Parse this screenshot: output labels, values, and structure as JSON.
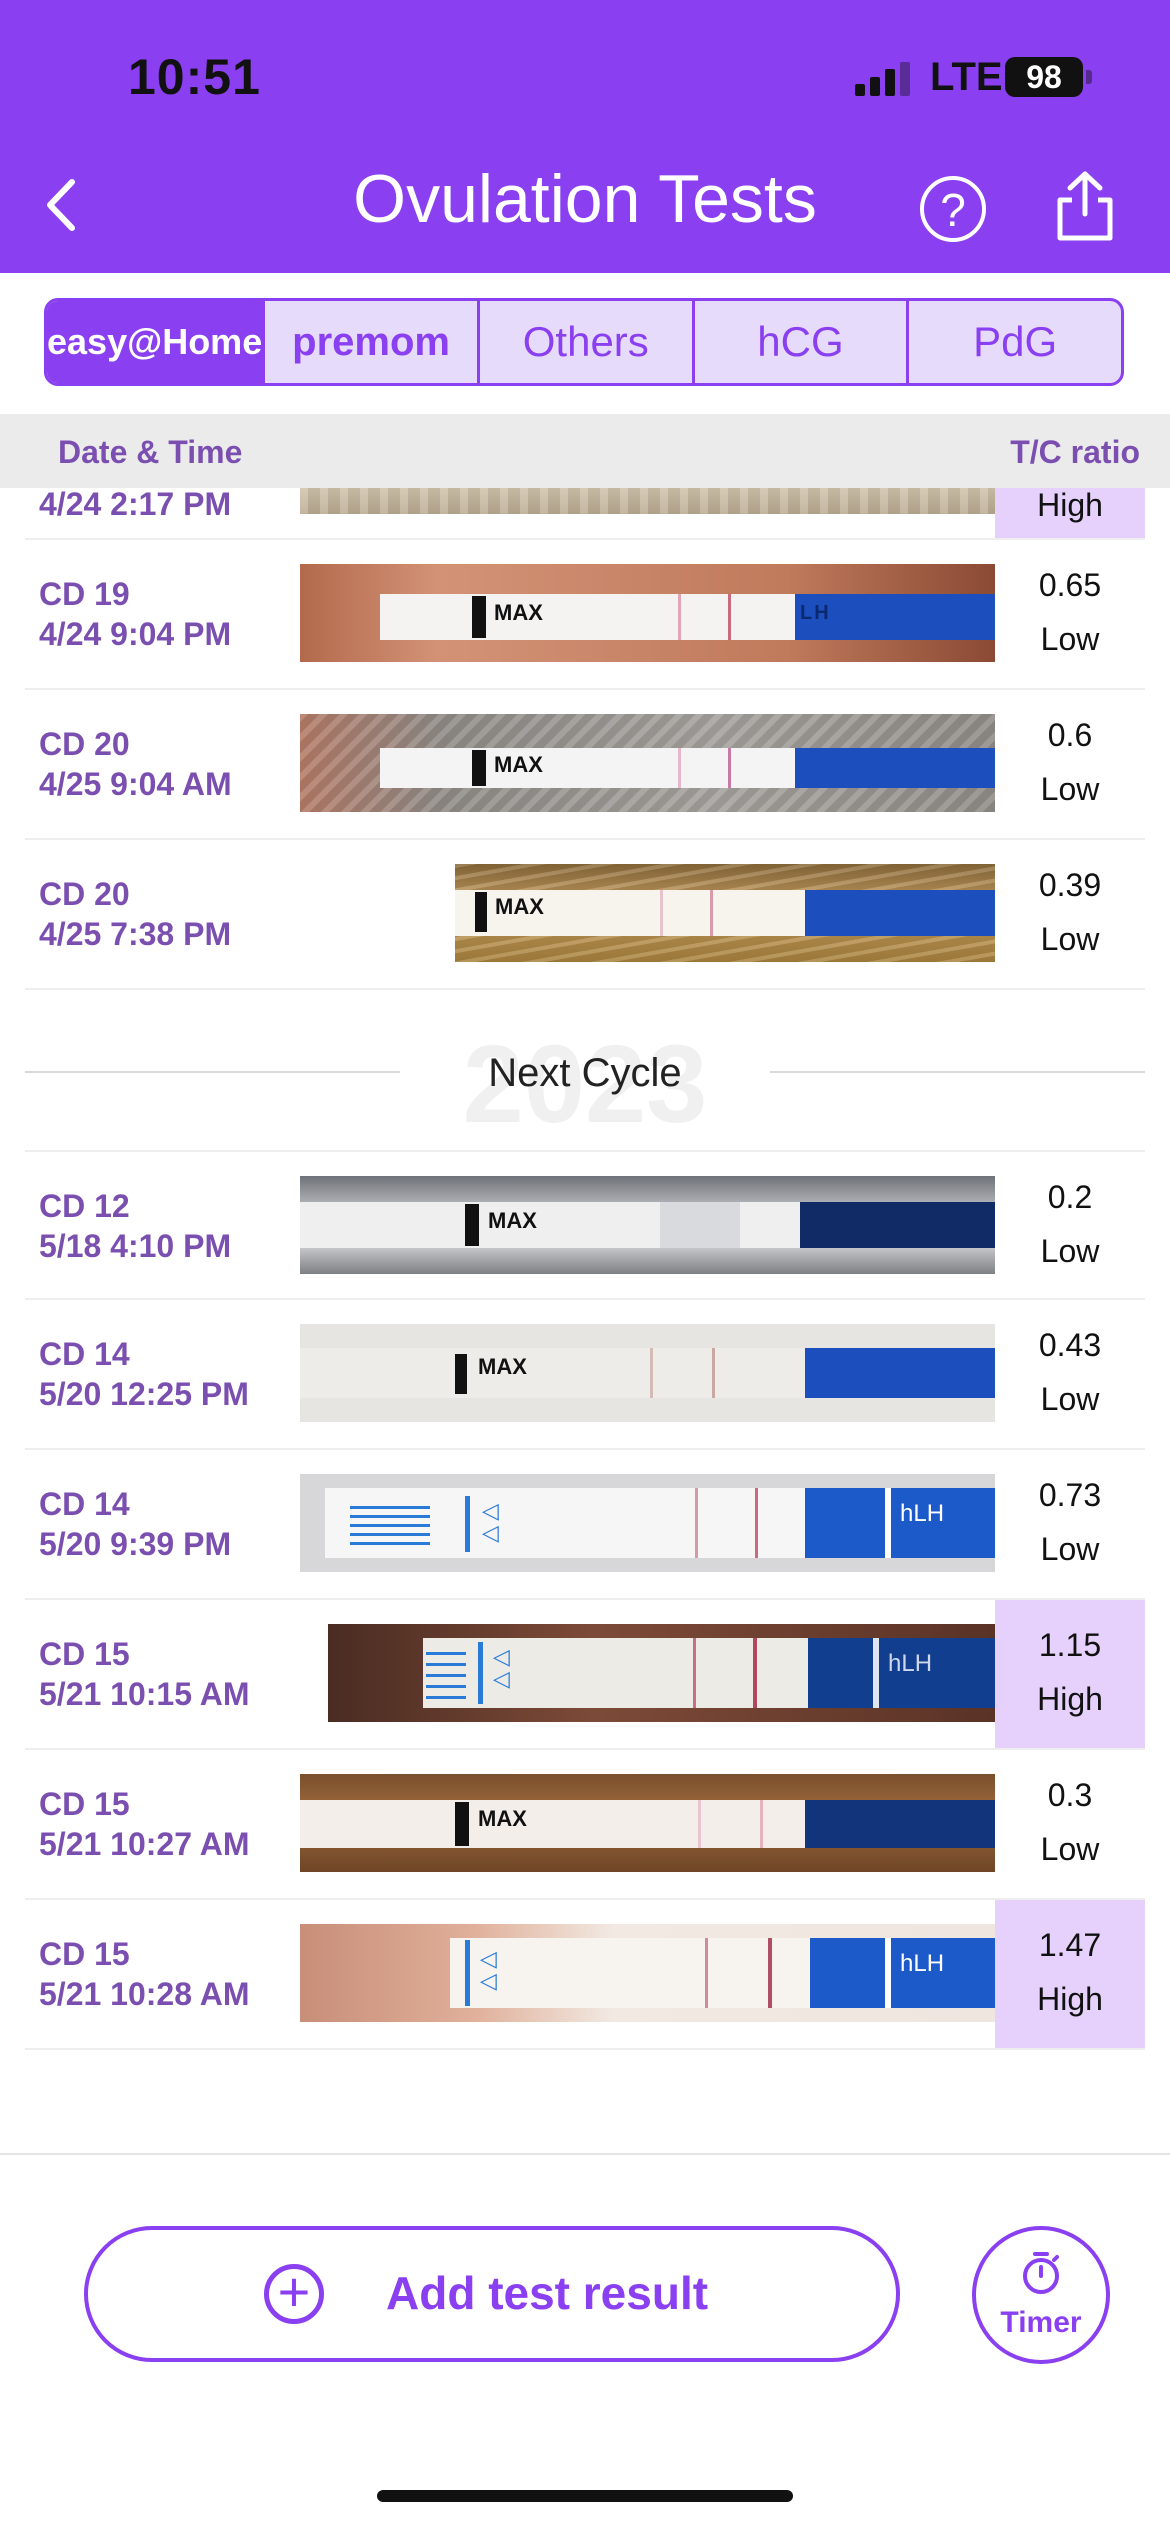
{
  "status_bar": {
    "time": "10:51",
    "network": "LTE",
    "battery": "98"
  },
  "header": {
    "title": "Ovulation Tests",
    "back_icon": "chevron-left-icon",
    "help_icon": "question-circle-icon",
    "share_icon": "share-icon"
  },
  "tabs": [
    {
      "label": "easy@Home",
      "active": true
    },
    {
      "label": "premom",
      "active": false
    },
    {
      "label": "Others",
      "active": false
    },
    {
      "label": "hCG",
      "active": false
    },
    {
      "label": "PdG",
      "active": false
    }
  ],
  "columns": {
    "date": "Date & Time",
    "ratio": "T/C ratio"
  },
  "rows": [
    {
      "cd": "",
      "datetime": "4/24 2:17 PM",
      "value": "",
      "level": "High"
    },
    {
      "cd": "CD 19",
      "datetime": "4/24 9:04 PM",
      "value": "0.65",
      "level": "Low"
    },
    {
      "cd": "CD 20",
      "datetime": "4/25 9:04 AM",
      "value": "0.6",
      "level": "Low"
    },
    {
      "cd": "CD 20",
      "datetime": "4/25 7:38 PM",
      "value": "0.39",
      "level": "Low"
    }
  ],
  "divider": {
    "ghost": "2023",
    "label": "Next Cycle"
  },
  "rows2": [
    {
      "cd": "CD 12",
      "datetime": "5/18 4:10 PM",
      "value": "0.2",
      "level": "Low"
    },
    {
      "cd": "CD 14",
      "datetime": "5/20 12:25 PM",
      "value": "0.43",
      "level": "Low"
    },
    {
      "cd": "CD 14",
      "datetime": "5/20 9:39 PM",
      "value": "0.73",
      "level": "Low"
    },
    {
      "cd": "CD 15",
      "datetime": "5/21 10:15 AM",
      "value": "1.15",
      "level": "High"
    },
    {
      "cd": "CD 15",
      "datetime": "5/21 10:27 AM",
      "value": "0.3",
      "level": "Low"
    },
    {
      "cd": "CD 15",
      "datetime": "5/21 10:28 AM",
      "value": "1.47",
      "level": "High"
    }
  ],
  "strip_marks": {
    "max": "MAX",
    "lh": "LH",
    "hlh": "hLH"
  },
  "footer": {
    "add_label": "Add test result",
    "timer_label": "Timer"
  }
}
